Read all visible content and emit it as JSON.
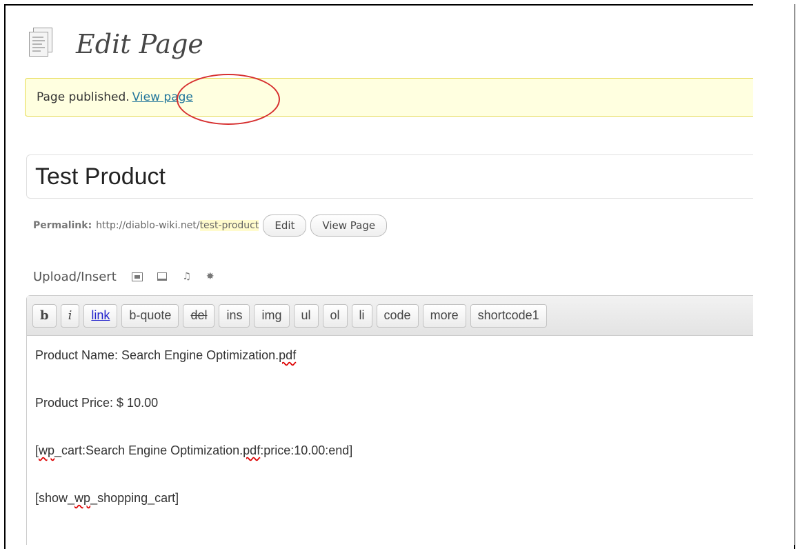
{
  "page": {
    "title": "Edit Page",
    "icon": "pages-icon"
  },
  "notice": {
    "text": "Page published.",
    "link": "View page"
  },
  "post_title": {
    "value": "Test Product"
  },
  "permalink": {
    "label": "Permalink:",
    "base": "http://diablo-wiki.net/",
    "slug": "test-product",
    "edit_button": "Edit",
    "view_button": "View Page"
  },
  "upload": {
    "label": "Upload/Insert",
    "icons": [
      "image-icon",
      "gallery-icon",
      "music-icon",
      "media-icon"
    ]
  },
  "toolbar": {
    "buttons": [
      "b",
      "i",
      "link",
      "b-quote",
      "del",
      "ins",
      "img",
      "ul",
      "ol",
      "li",
      "code",
      "more",
      "shortcode1"
    ]
  },
  "content": {
    "lines": [
      {
        "before": "Product Name:  Search Engine Optimization.",
        "squiggle": "pdf",
        "after": ""
      },
      {
        "before": "Product Price: $ 10.00",
        "squiggle": "",
        "after": ""
      },
      {
        "before": "[",
        "squiggle": "wp",
        "after": "_cart:Search Engine Optimization.",
        "squiggle2": "pdf",
        "after2": ":price:10.00:end]"
      },
      {
        "before": "[show_",
        "squiggle": "wp",
        "after": "_shopping_cart]"
      }
    ]
  }
}
